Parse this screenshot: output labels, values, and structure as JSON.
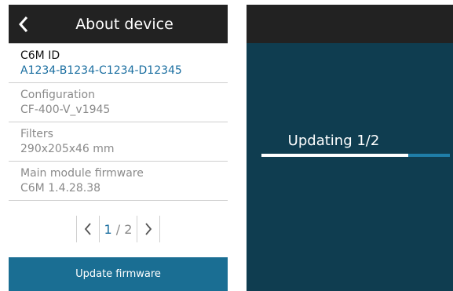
{
  "left_screen": {
    "title": "About device",
    "info_rows": [
      {
        "label": "C6M ID",
        "value": "A1234-B1234-C1234-D12345"
      },
      {
        "label": "Configuration",
        "value": "CF-400-V_v1945"
      },
      {
        "label": "Filters",
        "value": "290x205x46 mm"
      },
      {
        "label": "Main module firmware",
        "value": "C6M 1.4.28.38"
      }
    ],
    "pager": {
      "current": "1",
      "separator": "/",
      "total": "2"
    },
    "update_button": "Update firmware"
  },
  "right_screen": {
    "status_text": "Updating 1/2",
    "progress": 0.78
  },
  "colors": {
    "header_bg": "#222222",
    "accent_blue": "#1a6ea0",
    "button_blue": "#1a6e93",
    "update_bg": "#0f3d50"
  }
}
